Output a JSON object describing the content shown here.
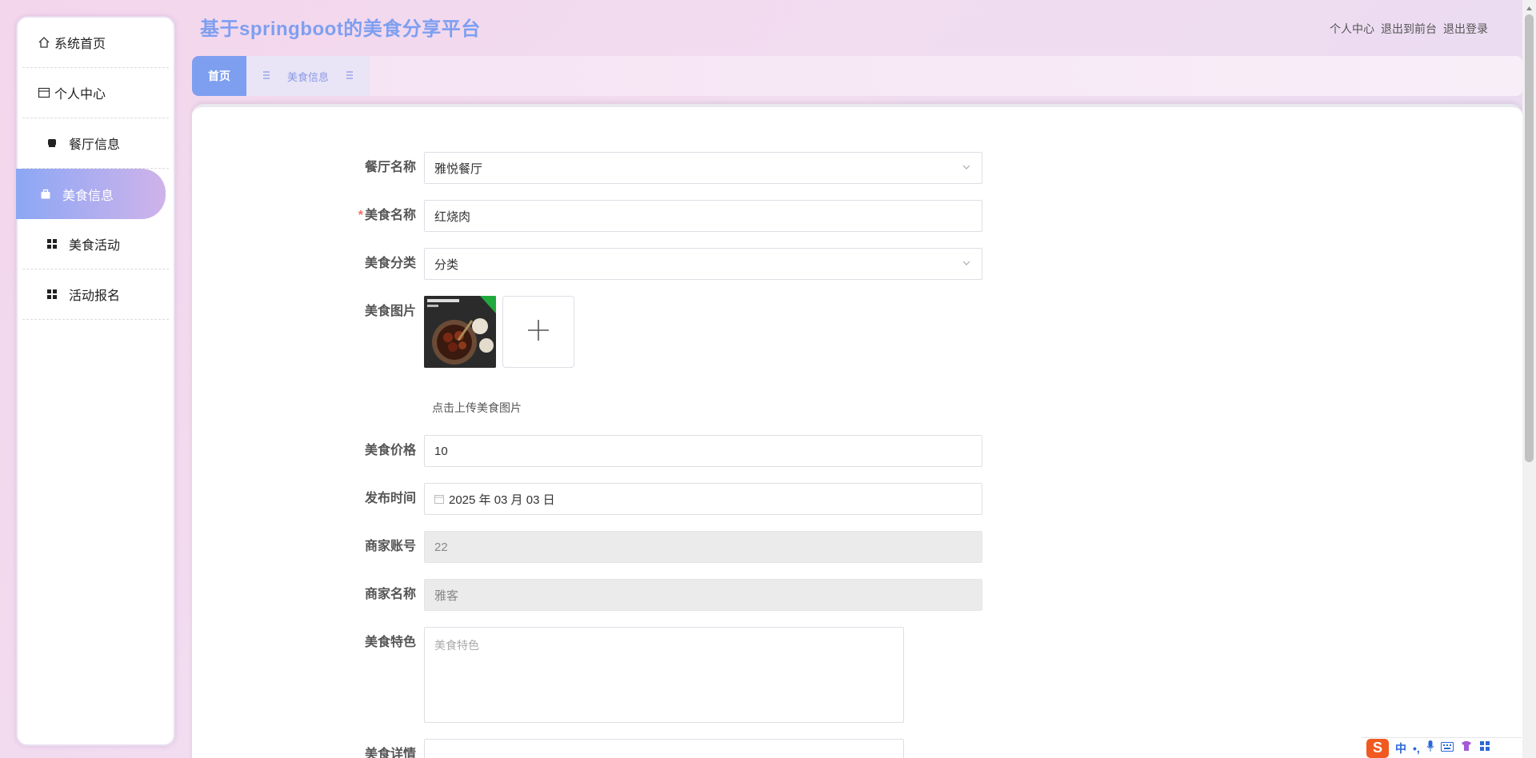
{
  "header": {
    "title": "基于springboot的美食分享平台",
    "links": [
      "个人中心",
      "退出到前台",
      "退出登录"
    ]
  },
  "sidebar": {
    "items": [
      {
        "label": "系统首页",
        "icon": "home-icon"
      },
      {
        "label": "个人中心",
        "icon": "user-card-icon"
      },
      {
        "label": "餐厅信息",
        "icon": "restaurant-icon"
      },
      {
        "label": "美食信息",
        "icon": "food-bag-icon",
        "active": true
      },
      {
        "label": "美食活动",
        "icon": "grid-icon"
      },
      {
        "label": "活动报名",
        "icon": "grid-icon"
      }
    ]
  },
  "tabs": {
    "home": "首页",
    "food": "美食信息"
  },
  "form": {
    "restaurant": {
      "label": "餐厅名称",
      "value": "雅悦餐厅"
    },
    "food_name": {
      "label": "美食名称",
      "value": "红烧肉",
      "required": true
    },
    "category": {
      "label": "美食分类",
      "value": "分类"
    },
    "image": {
      "label": "美食图片",
      "hint": "点击上传美食图片"
    },
    "price": {
      "label": "美食价格",
      "value": "10"
    },
    "publish_time": {
      "label": "发布时间",
      "value": "2025 年 03 月 03 日"
    },
    "merchant_account": {
      "label": "商家账号",
      "value": "22"
    },
    "merchant_name": {
      "label": "商家名称",
      "value": "雅客"
    },
    "feature": {
      "label": "美食特色",
      "placeholder": "美食特色"
    },
    "detail": {
      "label": "美食详情"
    }
  },
  "ime": {
    "s": "S",
    "lang": "中",
    "punct": "•,"
  },
  "colors": {
    "accent": "#7e9ff0",
    "active_gradient_start": "#8ca7f5",
    "active_gradient_end": "#cfb3ea",
    "required": "#f56c6c"
  }
}
